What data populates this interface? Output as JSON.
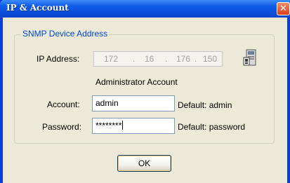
{
  "window": {
    "title": "IP & Account",
    "close_glyph": "✕"
  },
  "group": {
    "label": "SNMP Device Address"
  },
  "ip": {
    "label": "IP Address:",
    "octets": [
      "172",
      "16",
      "176",
      "150"
    ],
    "separators": [
      ".",
      ".",
      "."
    ]
  },
  "admin": {
    "heading": "Administrator Account",
    "account_label": "Account:",
    "account_value": "admin",
    "account_default": "Default: admin",
    "password_label": "Password:",
    "password_value": "********",
    "password_default": "Default: password"
  },
  "buttons": {
    "ok": "OK"
  },
  "icons": {
    "device": "device-icon"
  },
  "colors": {
    "titlebar": "#0a4fdc",
    "group_label": "#0046d5",
    "dialog_bg": "#ece9d8"
  }
}
